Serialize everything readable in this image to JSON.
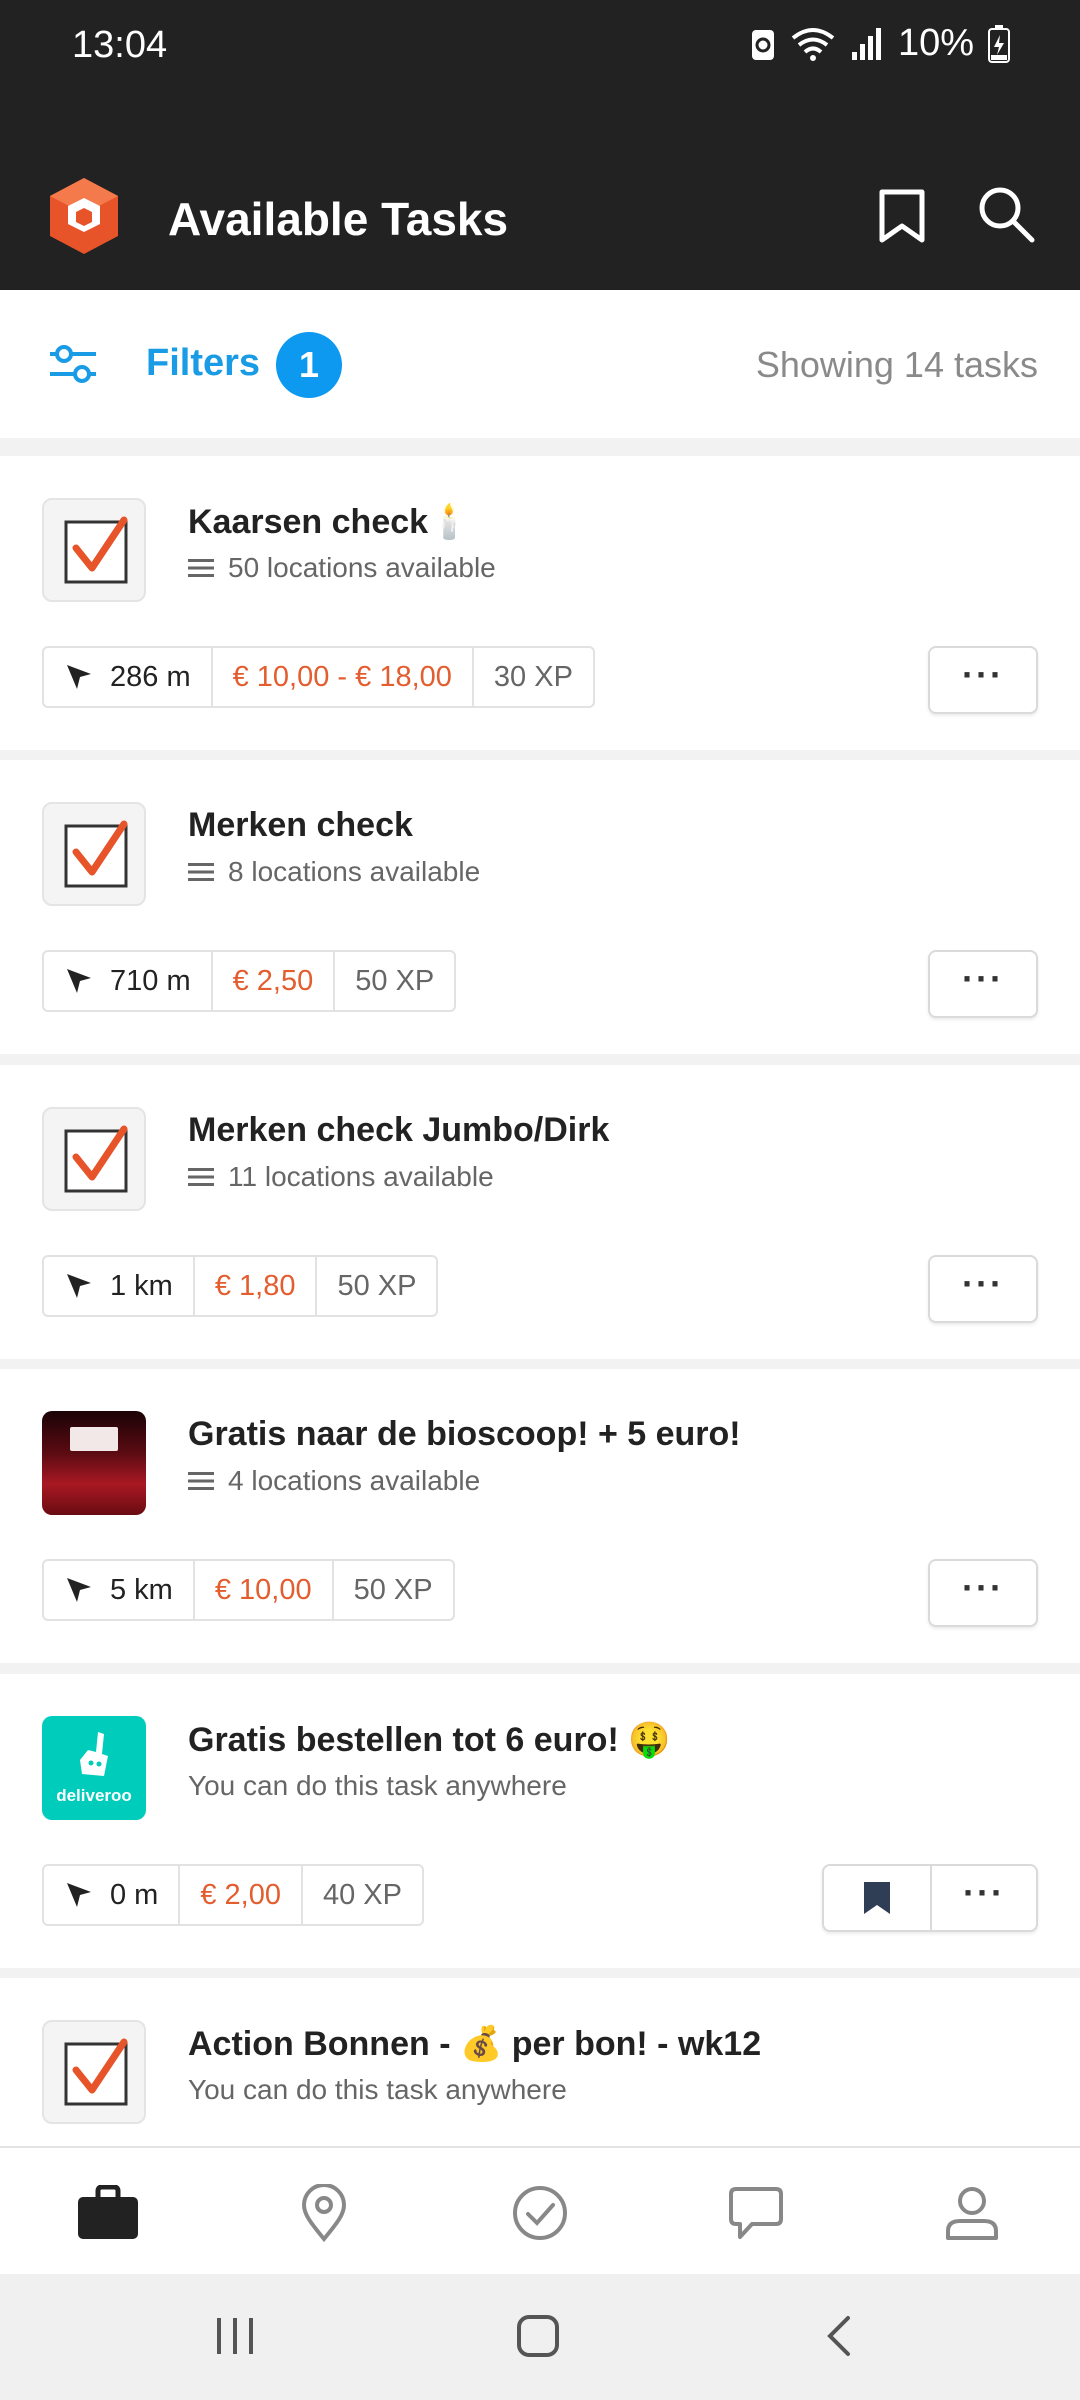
{
  "status_bar": {
    "time": "13:04",
    "battery": "10%"
  },
  "app_bar": {
    "title": "Available Tasks",
    "logo_icon": "app-logo",
    "bookmark_icon": "bookmark-outline-icon",
    "search_icon": "search-icon"
  },
  "filters": {
    "label": "Filters",
    "count": "1",
    "showing": "Showing 14 tasks"
  },
  "colors": {
    "accent_blue": "#1a9be6",
    "price_orange": "#e35d2e",
    "header_dark": "#222222"
  },
  "tasks": [
    {
      "name": "Kaarsen check🕯️",
      "subtitle": "50 locations available",
      "distance": "286 m",
      "price": "€ 10,00 - € 18,00",
      "xp": "30 XP",
      "thumb": "checkbox-icon"
    },
    {
      "name": "Merken check",
      "subtitle": "8 locations available",
      "distance": "710 m",
      "price": "€ 2,50",
      "xp": "50 XP",
      "thumb": "checkbox-icon"
    },
    {
      "name": "Merken check Jumbo/Dirk",
      "subtitle": "11 locations available",
      "distance": "1 km",
      "price": "€ 1,80",
      "xp": "50 XP",
      "thumb": "checkbox-icon"
    },
    {
      "name": "Gratis naar de bioscoop! + 5 euro!",
      "subtitle": "4 locations available",
      "distance": "5 km",
      "price": "€ 10,00",
      "xp": "50 XP",
      "thumb": "cinema-image"
    },
    {
      "name": "Gratis bestellen tot 6 euro! 🤑",
      "subtitle": "You can do this task anywhere",
      "distance": "0 m",
      "price": "€ 2,00",
      "xp": "40 XP",
      "thumb": "deliveroo-logo",
      "thumb_text": "deliveroo",
      "bookmarked": true
    },
    {
      "name": "Action Bonnen - 💰 per bon! - wk12",
      "subtitle": "You can do this task anywhere",
      "thumb": "checkbox-icon"
    }
  ],
  "bottom_nav": [
    "briefcase-icon",
    "location-pin-icon",
    "check-circle-icon",
    "chat-bubble-icon",
    "profile-icon"
  ]
}
